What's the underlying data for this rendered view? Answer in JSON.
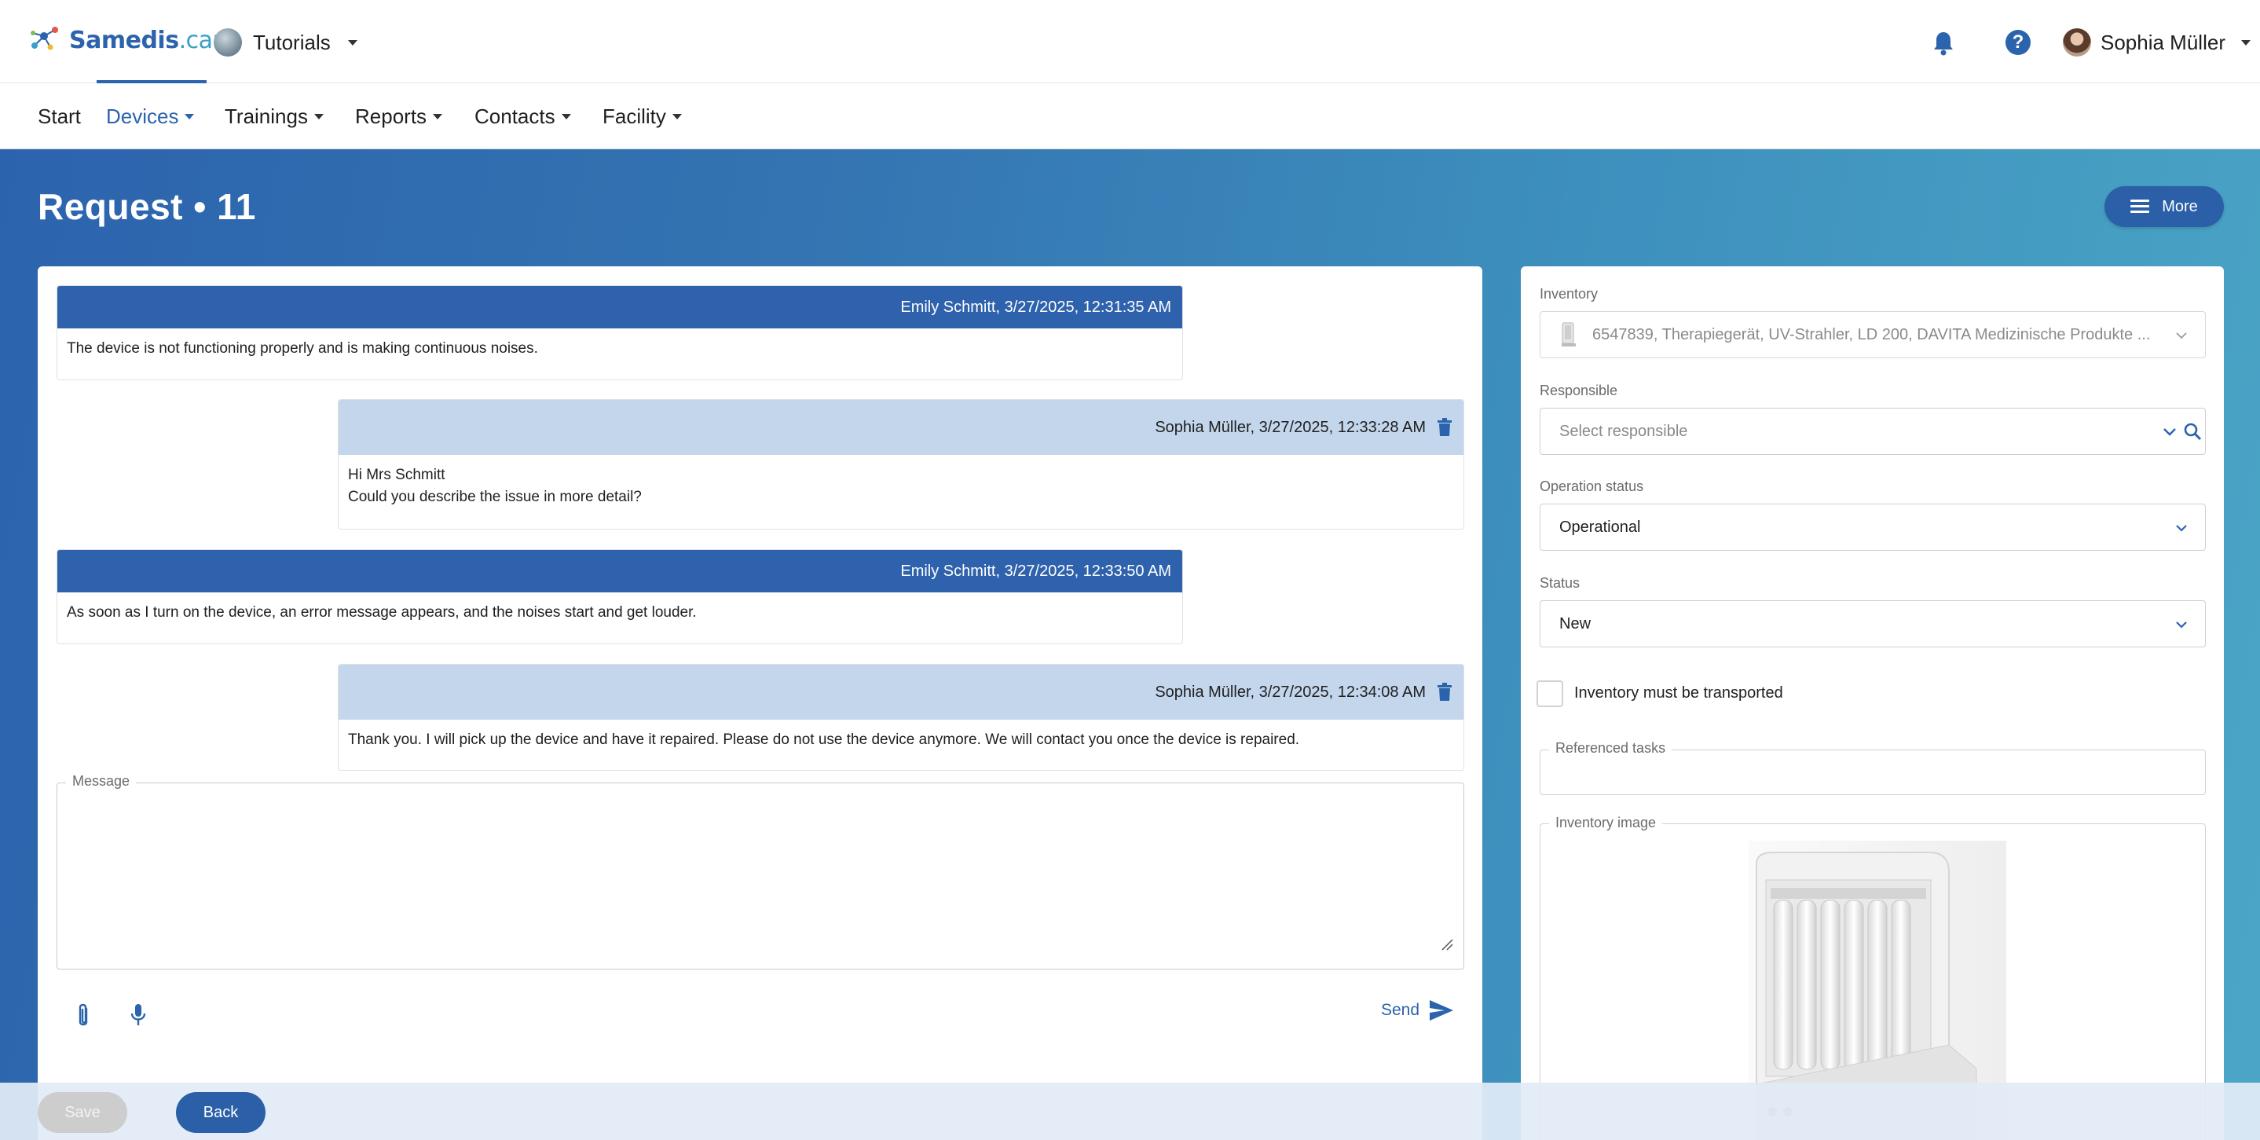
{
  "app": {
    "logo_name": "Samedis",
    "logo_suffix": ".care",
    "tenant": "Tutorials",
    "user": "Sophia Müller",
    "brand_color": "#2b63ad"
  },
  "nav": {
    "items": [
      {
        "label": "Start"
      },
      {
        "label": "Devices"
      },
      {
        "label": "Trainings"
      },
      {
        "label": "Reports"
      },
      {
        "label": "Contacts"
      },
      {
        "label": "Facility"
      }
    ],
    "active": "Devices"
  },
  "page": {
    "title": "Request • 11",
    "more_label": "More"
  },
  "chat": {
    "messages": [
      {
        "author_line": "Emily Schmitt, 3/27/2025, 12:31:35 AM",
        "body": [
          "The device is not functioning properly and is making continuous noises."
        ],
        "own": false
      },
      {
        "author_line": "Sophia Müller, 3/27/2025, 12:33:28 AM",
        "body": [
          "Hi Mrs Schmitt",
          "Could you describe the issue in more detail?"
        ],
        "own": true
      },
      {
        "author_line": "Emily Schmitt, 3/27/2025, 12:33:50 AM",
        "body": [
          "As soon as I turn on the device, an error message appears, and the noises start and get louder."
        ],
        "own": false
      },
      {
        "author_line": "Sophia Müller, 3/27/2025, 12:34:08 AM",
        "body": [
          "Thank you. I will pick up the device and have it repaired. Please do not use the device anymore. We will contact you once the device is repaired."
        ],
        "own": true
      }
    ],
    "message_label": "Message",
    "message_value": "",
    "send_label": "Send"
  },
  "side": {
    "inventory_label": "Inventory",
    "inventory_value": "6547839, Therapiegerät, UV-Strahler, LD 200, DAVITA Medizinische Produkte ...",
    "responsible_label": "Responsible",
    "responsible_placeholder": "Select responsible",
    "operation_status_label": "Operation status",
    "operation_status_value": "Operational",
    "status_label": "Status",
    "status_value": "New",
    "transport_label": "Inventory must be transported",
    "transport_checked": false,
    "referenced_tasks_label": "Referenced tasks",
    "inventory_image_label": "Inventory image"
  },
  "footer": {
    "save_label": "Save",
    "back_label": "Back"
  }
}
